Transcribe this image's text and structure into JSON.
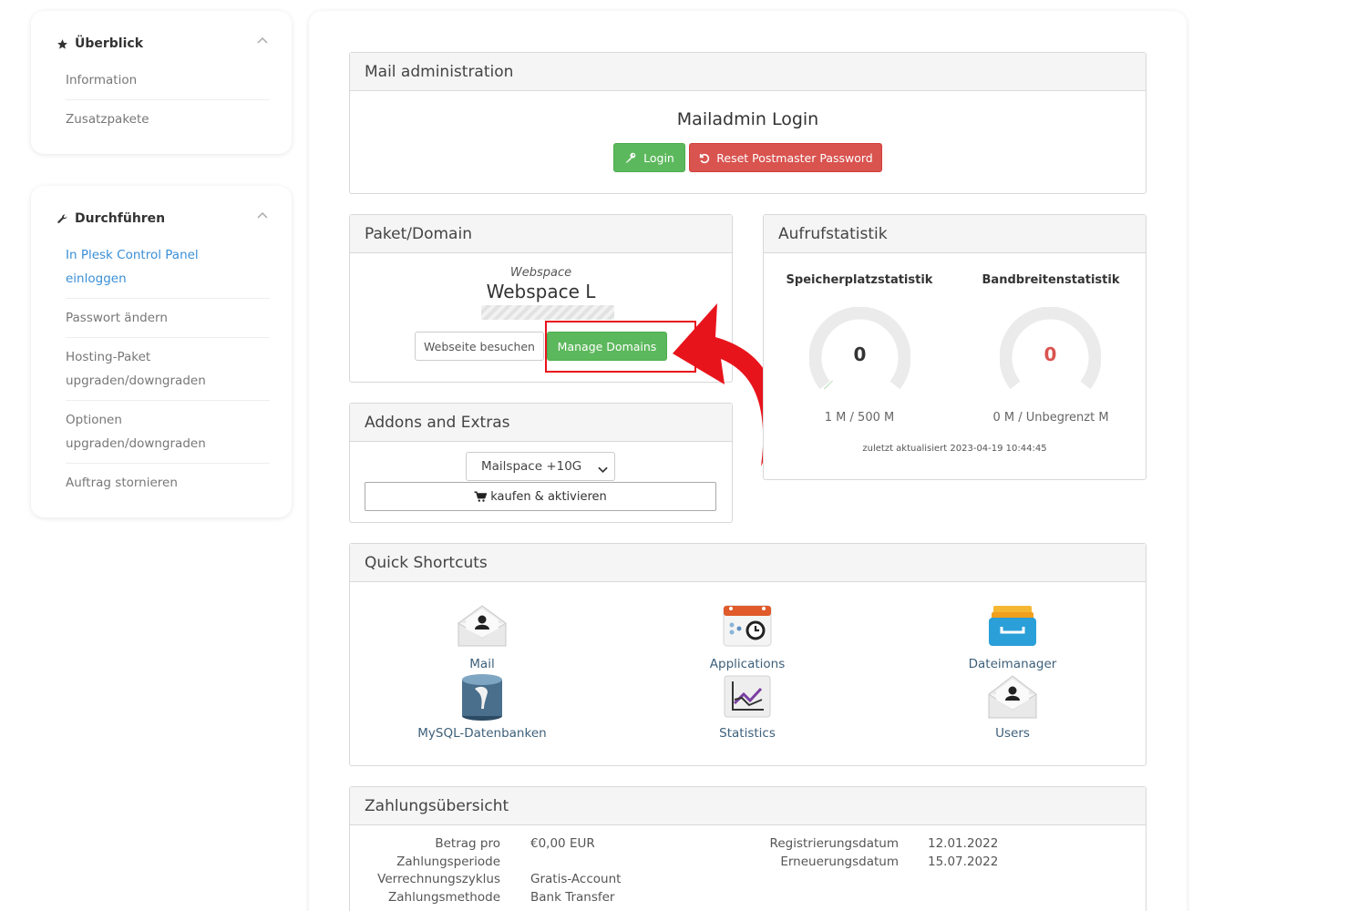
{
  "sidebar": {
    "overview": {
      "title": "Überblick",
      "items": [
        "Information",
        "Zusatzpakete"
      ]
    },
    "actions": {
      "title": "Durchführen",
      "items": [
        {
          "line1": "In Plesk Control Panel",
          "line2": "einloggen"
        },
        {
          "line1": "Passwort ändern",
          "line2": ""
        },
        {
          "line1": "Hosting-Paket",
          "line2": "upgraden/downgraden"
        },
        {
          "line1": "Optionen",
          "line2": "upgraden/downgraden"
        },
        {
          "line1": "Auftrag stornieren",
          "line2": ""
        }
      ]
    }
  },
  "mail_admin": {
    "title": "Mail administration",
    "heading": "Mailadmin Login",
    "login_label": "Login",
    "reset_label": "Reset Postmaster Password"
  },
  "package": {
    "title": "Paket/Domain",
    "type_label": "Webspace",
    "name": "Webspace L",
    "visit_label": "Webseite besuchen",
    "manage_label": "Manage Domains"
  },
  "addons": {
    "title": "Addons and Extras",
    "selected_option": "Mailspace +10G",
    "buy_label": "kaufen & aktivieren"
  },
  "stats": {
    "title": "Aufrufstatistik",
    "storage": {
      "title": "Speicherplatzstatistik",
      "value": "0",
      "usage": "1 M / 500 M",
      "fraction": 0.002
    },
    "bandwidth": {
      "title": "Bandbreitenstatistik",
      "value": "0",
      "usage": "0 M / Unbegrenzt M",
      "fraction": 0
    },
    "updated": "zuletzt aktualisiert 2023-04-19 10:44:45"
  },
  "shortcuts": {
    "title": "Quick Shortcuts",
    "items": [
      {
        "label": "Mail",
        "icon": "mail-icon"
      },
      {
        "label": "Applications",
        "icon": "applications-icon"
      },
      {
        "label": "Dateimanager",
        "icon": "file-manager-icon"
      },
      {
        "label": "MySQL-Datenbanken",
        "icon": "database-icon"
      },
      {
        "label": "Statistics",
        "icon": "statistics-icon"
      },
      {
        "label": "Users",
        "icon": "users-icon"
      }
    ]
  },
  "payment": {
    "title": "Zahlungsübersicht",
    "left_labels": [
      "Betrag pro",
      "Zahlungsperiode",
      "Verrechnungszyklus",
      "Zahlungsmethode"
    ],
    "left_values": [
      "€0,00 EUR",
      "",
      "Gratis-Account",
      "Bank Transfer"
    ],
    "right_labels": [
      "Registrierungsdatum",
      "Erneuerungsdatum"
    ],
    "right_values": [
      "12.01.2022",
      "15.07.2022"
    ]
  },
  "colors": {
    "green": "#5cb85c",
    "red": "#d9534f",
    "highlight": "#e8141c",
    "link": "#3a8fd6"
  }
}
